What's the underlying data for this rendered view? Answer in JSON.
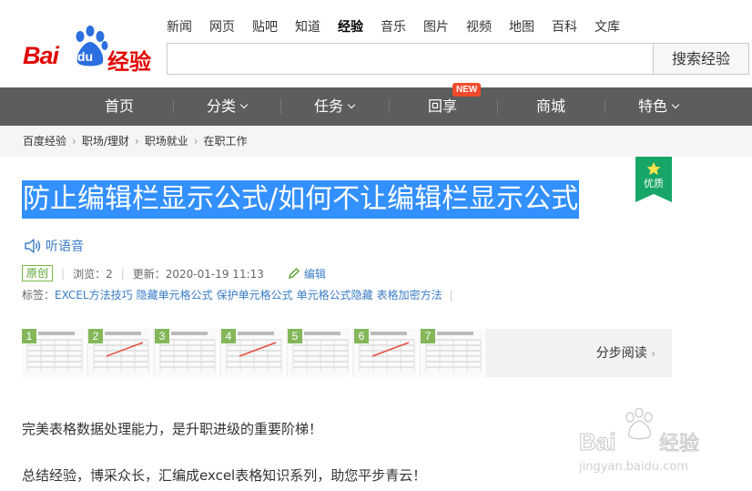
{
  "top_links": [
    {
      "label": "新闻",
      "active": false
    },
    {
      "label": "网页",
      "active": false
    },
    {
      "label": "贴吧",
      "active": false
    },
    {
      "label": "知道",
      "active": false
    },
    {
      "label": "经验",
      "active": true
    },
    {
      "label": "音乐",
      "active": false
    },
    {
      "label": "图片",
      "active": false
    },
    {
      "label": "视频",
      "active": false
    },
    {
      "label": "地图",
      "active": false
    },
    {
      "label": "百科",
      "active": false
    },
    {
      "label": "文库",
      "active": false
    }
  ],
  "logo": {
    "text_bai": "Bai",
    "text_du": "du",
    "text_jy": "经验"
  },
  "search": {
    "value": "",
    "button_label": "搜索经验"
  },
  "nav": {
    "items": [
      {
        "label": "首页",
        "has_caret": false
      },
      {
        "label": "分类",
        "has_caret": true
      },
      {
        "label": "任务",
        "has_caret": true
      },
      {
        "label": "回享",
        "has_caret": false
      },
      {
        "label": "商城",
        "has_caret": false
      },
      {
        "label": "特色",
        "has_caret": true
      }
    ],
    "new_badge": "NEW"
  },
  "breadcrumb": [
    "百度经验",
    "职场/理财",
    "职场就业",
    "在职工作"
  ],
  "quality_badge": "优质",
  "article": {
    "title": "防止编辑栏显示公式/如何不让编辑栏显示公式",
    "listen_label": "听语音",
    "original_badge": "原创",
    "views_label": "浏览：2",
    "updated_label": "更新：2020-01-19 11:13",
    "edit_label": "编辑",
    "tags_prefix": "标签：",
    "tags": [
      "EXCEL方法技巧",
      "隐藏单元格公式",
      "保护单元格公式",
      "单元格公式隐藏",
      "表格加密方法"
    ],
    "step_numbers": [
      "1",
      "2",
      "3",
      "4",
      "5",
      "6",
      "7"
    ],
    "steps_link": "分步阅读",
    "paragraphs": [
      "完美表格数据处理能力，是升职进级的重要阶梯！",
      "总结经验，博采众长，汇编成excel表格知识系列，助您平步青云！"
    ]
  },
  "watermark": {
    "brand": "Bai经验",
    "url": "jingyan.baidu.com"
  },
  "colors": {
    "brand_red": "#e10602",
    "nav_bg": "#5d5d5d",
    "link_blue": "#3a7cc5",
    "title_highlight": "#3390ff",
    "quality_green": "#17a667"
  }
}
